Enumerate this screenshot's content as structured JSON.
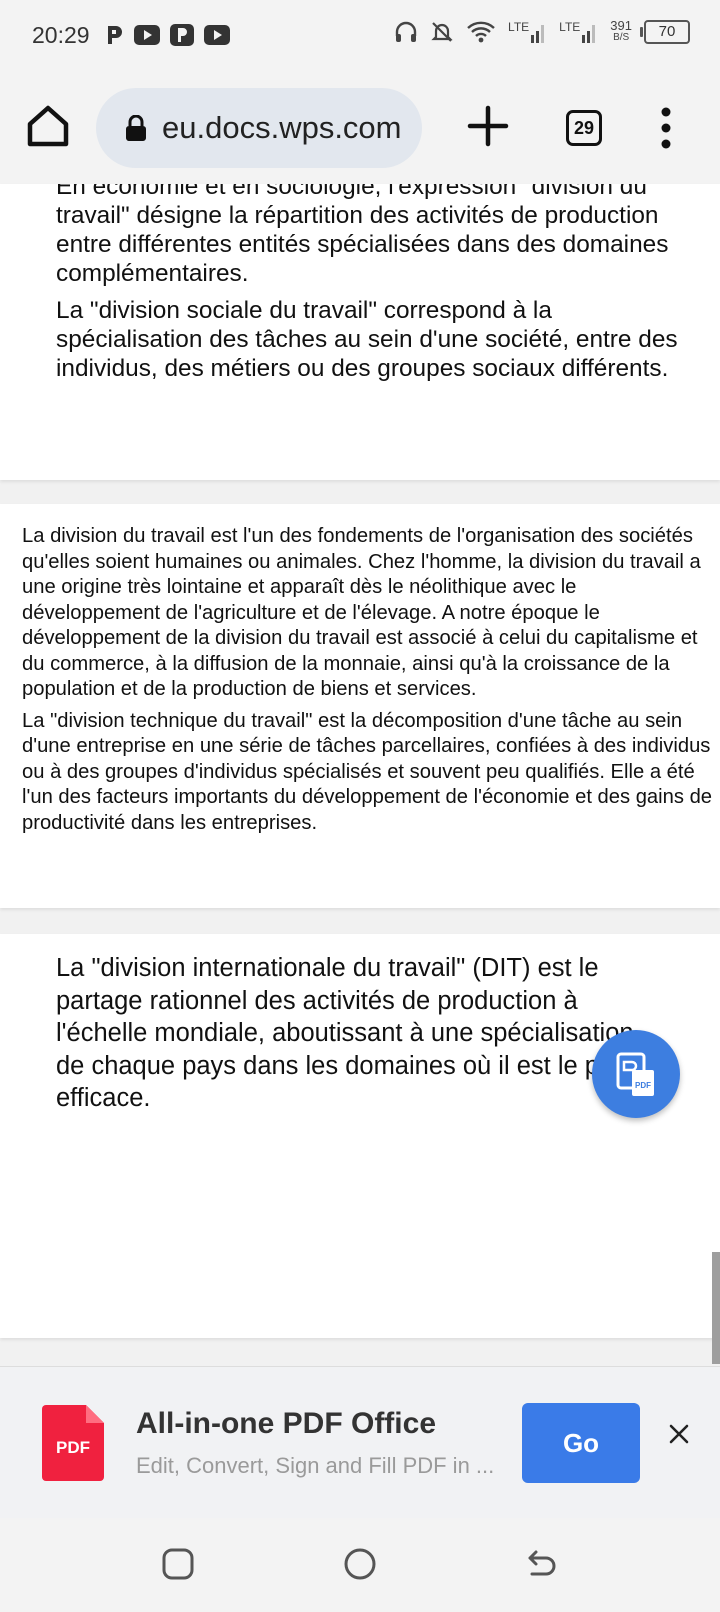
{
  "status_bar": {
    "time": "20:29",
    "left_icons": [
      "p-app-icon",
      "youtube-icon",
      "p-app-icon",
      "youtube-icon"
    ],
    "right_icons": [
      "headphones-icon",
      "mute-icon",
      "wifi-icon"
    ],
    "network1": "LTE",
    "network2": "LTE",
    "speed_value": "391",
    "speed_unit": "B/S",
    "battery": "70"
  },
  "browser": {
    "url": "eu.docs.wps.com",
    "tab_count": "29"
  },
  "document": {
    "page1": {
      "cut_line": "En économie et en sociologie, l'expression \"division du",
      "paragraphs": [
        "travail\" désigne la répartition des activités de production entre différentes entités spécialisées dans des domaines complémentaires.",
        "La \"division sociale du travail\" correspond à la spécialisation des tâches au sein d'une société, entre des individus, des métiers ou des groupes sociaux différents."
      ]
    },
    "page2": {
      "paragraphs": [
        "La division du travail est l'un des fondements de l'organisation des sociétés qu'elles soient humaines ou animales. Chez l'homme, la division du travail a une origine très lointaine et apparaît dès le néolithique avec le développement de l'agriculture et de l'élevage. A notre époque le développement de la division du travail est associé à celui du capitalisme et du commerce, à la diffusion de la monnaie, ainsi qu'à la croissance de la population et de la production de biens et services.",
        "La \"division technique du travail\" est la décomposition d'une tâche au sein d'une entreprise en une série de tâches parcellaires, confiées à des individus ou à des groupes d'individus spécialisés et souvent peu qualifiés. Elle a été l'un des facteurs importants du développement de l'économie et des gains de productivité dans les entreprises."
      ]
    },
    "page3": {
      "paragraphs": [
        "La \"division internationale du travail\" (DIT) est le partage rationnel des activités de production à l'échelle mondiale, aboutissant à une spécialisation de chaque pays dans les domaines où il est le plus efficace."
      ]
    },
    "fab_icon": "pdf-convert-icon",
    "fab_label": "PDF"
  },
  "ad": {
    "icon_label": "PDF",
    "title": "All-in-one PDF Office",
    "subtitle": "Edit, Convert, Sign and Fill PDF in ...",
    "button": "Go"
  },
  "colors": {
    "accent_blue": "#3a7be8",
    "pdf_red": "#f0213f"
  }
}
